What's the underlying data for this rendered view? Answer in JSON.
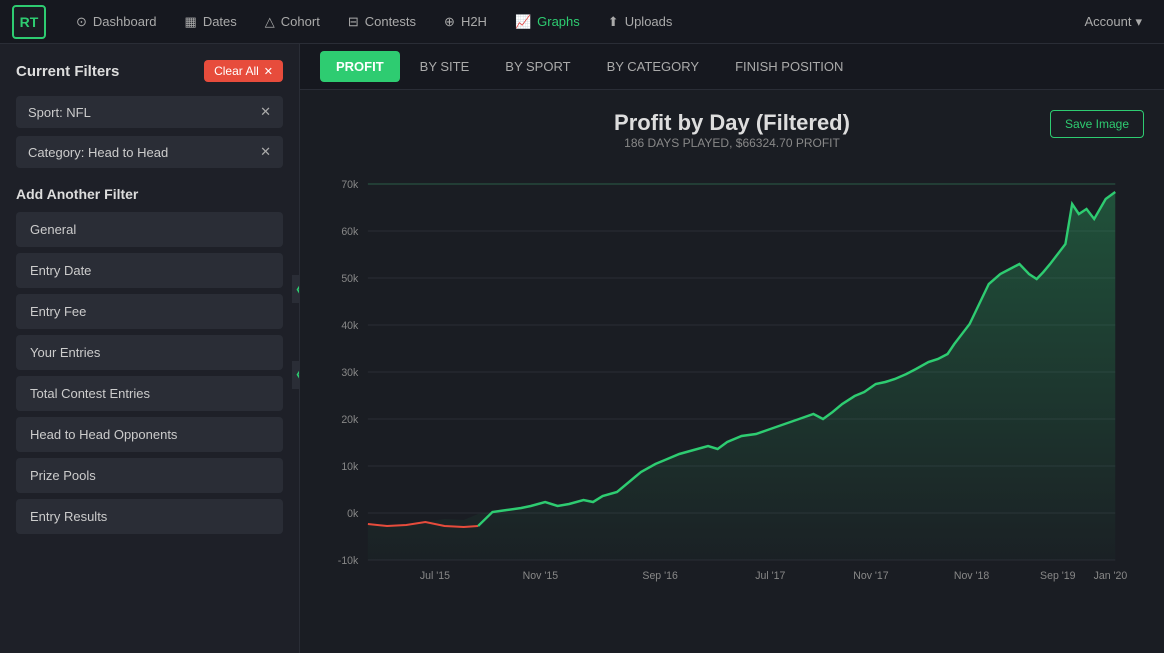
{
  "app": {
    "logo": "RT",
    "nav": {
      "items": [
        {
          "label": "Dashboard",
          "icon": "⊙",
          "active": false
        },
        {
          "label": "Dates",
          "icon": "📅",
          "active": false
        },
        {
          "label": "Cohort",
          "icon": "△",
          "active": false
        },
        {
          "label": "Contests",
          "icon": "⊟",
          "active": false
        },
        {
          "label": "H2H",
          "icon": "⊕",
          "active": false
        },
        {
          "label": "Graphs",
          "icon": "📈",
          "active": true
        },
        {
          "label": "Uploads",
          "icon": "⬆",
          "active": false
        }
      ],
      "account_label": "Account"
    }
  },
  "sidebar": {
    "title": "Current Filters",
    "clear_all_label": "Clear All",
    "filters": [
      {
        "label": "Sport: NFL"
      },
      {
        "label": "Category: Head to Head"
      }
    ],
    "add_filter_title": "Add Another Filter",
    "filter_buttons": [
      {
        "label": "General"
      },
      {
        "label": "Entry Date"
      },
      {
        "label": "Entry Fee"
      },
      {
        "label": "Your Entries"
      },
      {
        "label": "Total Contest Entries"
      },
      {
        "label": "Head to Head Opponents"
      },
      {
        "label": "Prize Pools"
      },
      {
        "label": "Entry Results"
      }
    ]
  },
  "chart": {
    "tabs": [
      {
        "label": "PROFIT",
        "active": true
      },
      {
        "label": "BY SITE",
        "active": false
      },
      {
        "label": "BY SPORT",
        "active": false
      },
      {
        "label": "BY CATEGORY",
        "active": false
      },
      {
        "label": "FINISH POSITION",
        "active": false
      }
    ],
    "title": "Profit by Day (Filtered)",
    "subtitle": "186 DAYS PLAYED, $66324.70 PROFIT",
    "save_image_label": "Save Image",
    "y_axis_labels": [
      "70k",
      "60k",
      "50k",
      "40k",
      "30k",
      "20k",
      "10k",
      "0k",
      "-10k"
    ],
    "x_axis_labels": [
      "Jul '15",
      "Nov '15",
      "Sep '16",
      "Jul '17",
      "Nov '17",
      "Nov '18",
      "Sep '19",
      "Jan '20"
    ],
    "accent_color": "#2ecc71",
    "reference_line_color": "#2ecc71",
    "line_color": "#2ecc71",
    "negative_color": "#e74c3c"
  }
}
